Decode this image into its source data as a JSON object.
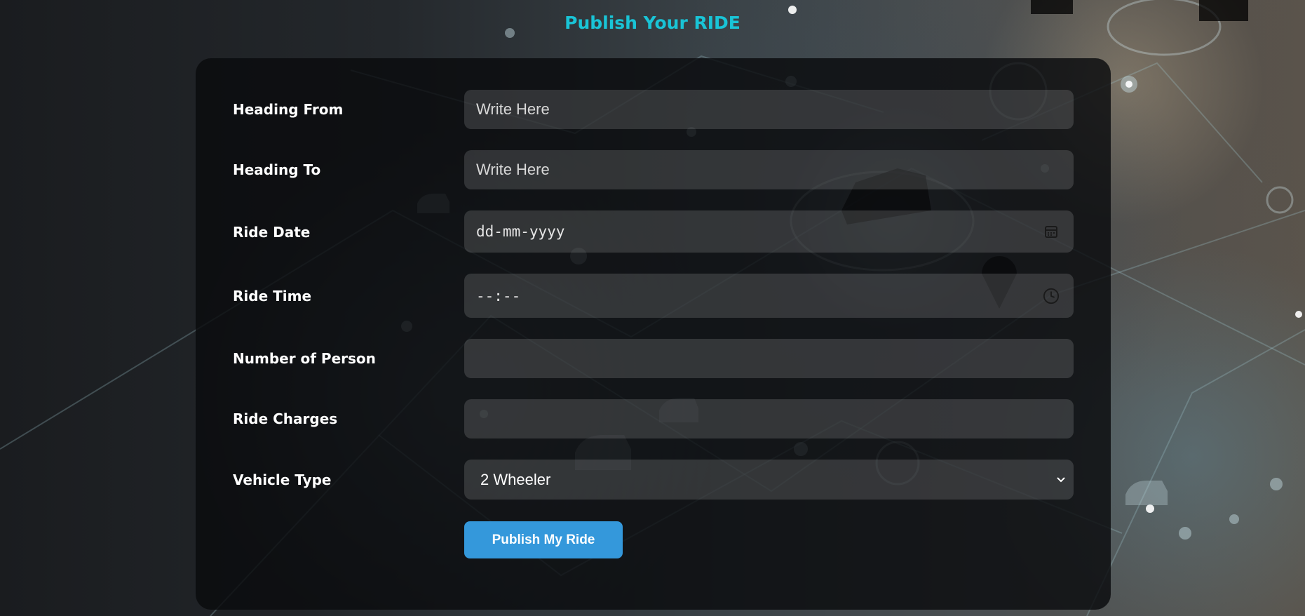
{
  "page": {
    "title": "Publish Your RIDE"
  },
  "form": {
    "heading_from": {
      "label": "Heading From",
      "placeholder": "Write Here",
      "value": ""
    },
    "heading_to": {
      "label": "Heading To",
      "placeholder": "Write Here",
      "value": ""
    },
    "ride_date": {
      "label": "Ride Date",
      "placeholder": "dd-mm-yyyy",
      "icon": "calendar-icon"
    },
    "ride_time": {
      "label": "Ride Time",
      "placeholder": "--:--",
      "icon": "clock-icon"
    },
    "number_of_person": {
      "label": "Number of Person",
      "value": ""
    },
    "ride_charges": {
      "label": "Ride Charges",
      "value": ""
    },
    "vehicle_type": {
      "label": "Vehicle Type",
      "selected": "2 Wheeler",
      "icon": "chevron-down-icon"
    },
    "submit_label": "Publish My Ride"
  },
  "colors": {
    "title": "#19c4d6",
    "button": "#3498db",
    "card": "#0a0b0d"
  }
}
